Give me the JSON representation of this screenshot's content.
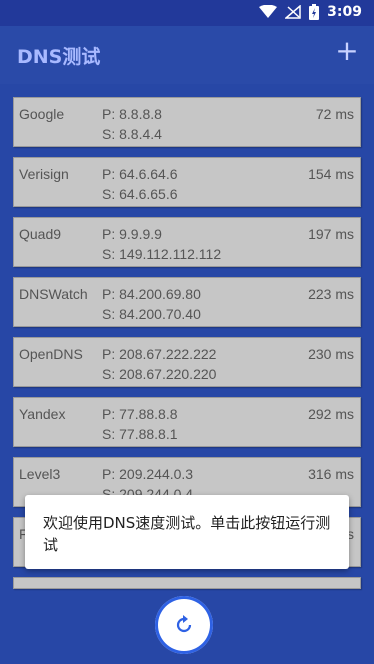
{
  "statusbar": {
    "time": "3:09"
  },
  "header": {
    "title": "DNS测试",
    "add_label": "+"
  },
  "servers": [
    {
      "name": "Google",
      "primary": "P: 8.8.8.8",
      "secondary": "S: 8.8.4.4",
      "latency": "72 ms"
    },
    {
      "name": "Verisign",
      "primary": "P: 64.6.64.6",
      "secondary": "S: 64.6.65.6",
      "latency": "154 ms"
    },
    {
      "name": "Quad9",
      "primary": "P: 9.9.9.9",
      "secondary": "S: 149.112.112.112",
      "latency": "197 ms"
    },
    {
      "name": "DNSWatch",
      "primary": "P: 84.200.69.80",
      "secondary": "S: 84.200.70.40",
      "latency": "223 ms"
    },
    {
      "name": "OpenDNS",
      "primary": "P: 208.67.222.222",
      "secondary": "S: 208.67.220.220",
      "latency": "230 ms"
    },
    {
      "name": "Yandex",
      "primary": "P: 77.88.8.8",
      "secondary": "S: 77.88.8.1",
      "latency": "292 ms"
    },
    {
      "name": "Level3",
      "primary": "P: 209.244.0.3",
      "secondary": "S: 209.244.0.4",
      "latency": "316 ms"
    },
    {
      "name": "F",
      "primary": "",
      "secondary": "",
      "latency": "s"
    }
  ],
  "toast": {
    "message": "欢迎使用DNS速度测试。单击此按钮运行测试"
  },
  "colors": {
    "background": "#2747a6",
    "row": "#c6c6c6",
    "accent": "#2e61e4"
  },
  "icons": {
    "wifi": "wifi-icon",
    "signal": "no-signal-icon",
    "battery": "battery-charging-icon",
    "add": "add-icon",
    "refresh": "refresh-icon"
  }
}
